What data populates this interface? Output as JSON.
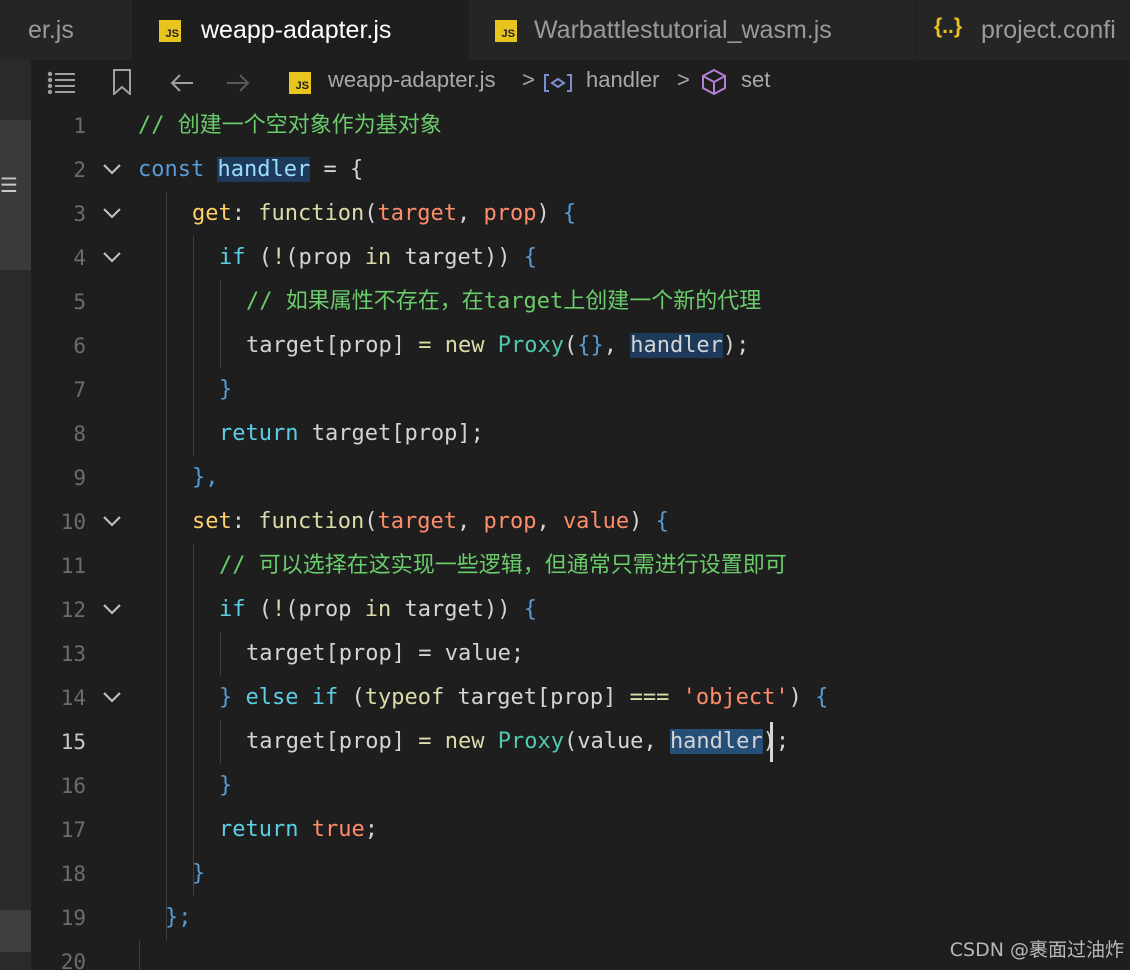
{
  "tabs": [
    {
      "label": "er.js",
      "icon": "js-file-icon",
      "active": false
    },
    {
      "label": "weapp-adapter.js",
      "icon": "js-file-icon",
      "active": true
    },
    {
      "label": "Warbattlestutorial_wasm.js",
      "icon": "js-file-icon",
      "active": false
    },
    {
      "label": "project.confi",
      "icon": "json-braces-icon",
      "active": false
    }
  ],
  "tab_icon_text": {
    "js": "JS",
    "json": "{..}",
    "close": "×"
  },
  "breadcrumb": {
    "file": "weapp-adapter.js",
    "symbol": "handler",
    "member": "set",
    "separator": ">"
  },
  "code": {
    "line_numbers": [
      "1",
      "2",
      "3",
      "4",
      "5",
      "6",
      "7",
      "8",
      "9",
      "10",
      "11",
      "12",
      "13",
      "14",
      "15",
      "16",
      "17",
      "18",
      "19",
      "20"
    ],
    "current_line": "15",
    "folded_lines": [
      "2",
      "3",
      "4",
      "10",
      "12",
      "14"
    ],
    "tokens": {
      "l1_comment": "// 创建一个空对象作为基对象",
      "l2_const": "const",
      "l2_handler": "handler",
      "l2_rest": " = {",
      "l3_get": "get",
      "l3_colon": ": ",
      "l3_function": "function",
      "l3_paren_open": "(",
      "l3_target": "target",
      "l3_comma": ", ",
      "l3_prop": "prop",
      "l3_paren_close": ")",
      "l3_brace": " {",
      "l4_if": "if",
      "l4_open": " (",
      "l4_not": "!",
      "l4_paren": "(",
      "l4_prop": "prop",
      "l4_in": " in ",
      "l4_target": "target",
      "l4_close": "))",
      "l4_brace": " {",
      "l5_comment": "// 如果属性不存在，在target上创建一个新的代理",
      "l6_target": "target",
      "l6_bracket_open": "[",
      "l6_prop": "prop",
      "l6_bracket_close": "]",
      "l6_eq": " = ",
      "l6_new": "new",
      "l6_sp": " ",
      "l6_proxy": "Proxy",
      "l6_open": "(",
      "l6_obj": "{}",
      "l6_comma": ", ",
      "l6_handler": "handler",
      "l6_close": ");",
      "l7_brace": "}",
      "l8_return": "return",
      "l8_rest": " target[prop];",
      "l9_brace": "},",
      "l10_set": "set",
      "l10_colon": ": ",
      "l10_function": "function",
      "l10_open": "(",
      "l10_target": "target",
      "l10_comma1": ", ",
      "l10_prop": "prop",
      "l10_comma2": ", ",
      "l10_value": "value",
      "l10_close": ")",
      "l10_brace": " {",
      "l11_comment": "// 可以选择在这实现一些逻辑，但通常只需进行设置即可",
      "l12_if": "if",
      "l12_open": " (",
      "l12_not": "!",
      "l12_paren": "(",
      "l12_prop": "prop",
      "l12_in": " in ",
      "l12_target": "target",
      "l12_close": "))",
      "l12_brace": " {",
      "l13_target": "target",
      "l13_bracket_open": "[",
      "l13_prop": "prop",
      "l13_bracket_close": "]",
      "l13_rest": " = value;",
      "l14_brace": "}",
      "l14_else": " else ",
      "l14_if": "if",
      "l14_open": " (",
      "l14_typeof": "typeof",
      "l14_target": " target[prop]",
      "l14_eq": " === ",
      "l14_q1": "'",
      "l14_str": "object",
      "l14_q2": "'",
      "l14_close": ")",
      "l14_ob": " {",
      "l15_target": "target",
      "l15_bracket_open": "[",
      "l15_prop": "prop",
      "l15_bracket_close": "]",
      "l15_eq": " = ",
      "l15_new": "new",
      "l15_sp": " ",
      "l15_proxy": "Proxy",
      "l15_open": "(",
      "l15_value": "value",
      "l15_comma": ", ",
      "l15_handler": "handler",
      "l15_close": ");",
      "l16_brace": "}",
      "l17_return": "return",
      "l17_sp": " ",
      "l17_true": "true",
      "l17_semi": ";",
      "l18_brace": "}",
      "l19_brace": "};"
    }
  },
  "watermark": "CSDN @裹面过油炸",
  "colors": {
    "keyword": "#569cd6",
    "function": "#dcdcaa",
    "variable": "#9cdcfe",
    "parameter": "#ff8c6b",
    "comment": "#6acc6a",
    "class": "#4ec9b0",
    "js_badge": "#e8c41f",
    "selection": "#264f78"
  }
}
